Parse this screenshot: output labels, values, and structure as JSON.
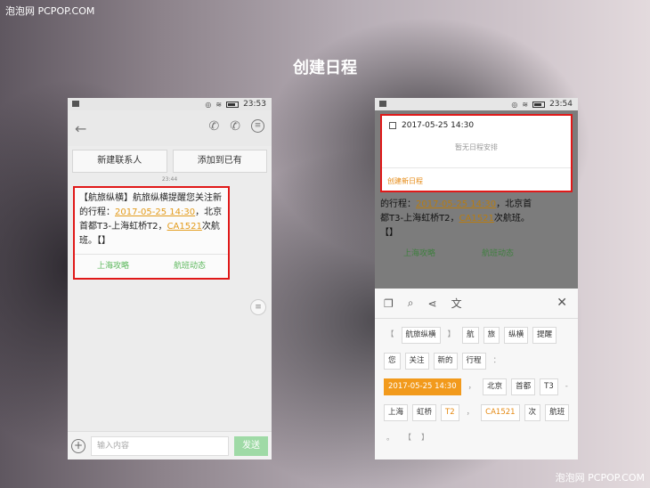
{
  "watermark": {
    "top": "泡泡网 PCPOP.COM",
    "bottom": "泡泡网 PCPOP.COM"
  },
  "page_title": "创建日程",
  "left_phone": {
    "status_time": "23:53",
    "buttons": {
      "new_contact": "新建联系人",
      "add_existing": "添加到已有"
    },
    "timestamp": "23:44",
    "message": {
      "prefix": "【航旅纵横】航旅纵横提醒您关注新的行程：",
      "date_link": "2017-05-25 14:30",
      "middle": "，北京首都T3-上海虹桥T2，",
      "flight_link": "CA1521",
      "suffix": "次航班。【】"
    },
    "actions": {
      "guide": "上海攻略",
      "flight_status": "航班动态"
    },
    "input_placeholder": "输入内容",
    "send_label": "发送"
  },
  "right_phone": {
    "status_time": "23:54",
    "schedule": {
      "date": "2017-05-25 14:30",
      "empty_text": "暂无日程安排",
      "create_label": "创建新日程"
    },
    "bg_message": {
      "prefix": "的行程：",
      "date_link": "2017-05-25 14:30",
      "middle": "，北京首都T3-上海虹桥T2，",
      "flight_link": "CA1521",
      "suffix": "次航班。【】"
    },
    "bg_actions": {
      "guide": "上海攻略",
      "flight_status": "航班动态"
    },
    "chips": {
      "row1": [
        "【",
        "航旅纵横",
        "】",
        "航",
        "旅",
        "纵横",
        "提醒"
      ],
      "row2": [
        "您",
        "关注",
        "新的",
        "行程",
        "："
      ],
      "row3": [
        "2017-05-25 14:30",
        "，",
        "北京",
        "首都",
        "T3",
        "-"
      ],
      "row4": [
        "上海",
        "虹桥",
        "T2",
        "，",
        "CA1521",
        "次",
        "航班"
      ],
      "row5": [
        "。",
        "【",
        "】"
      ]
    }
  }
}
